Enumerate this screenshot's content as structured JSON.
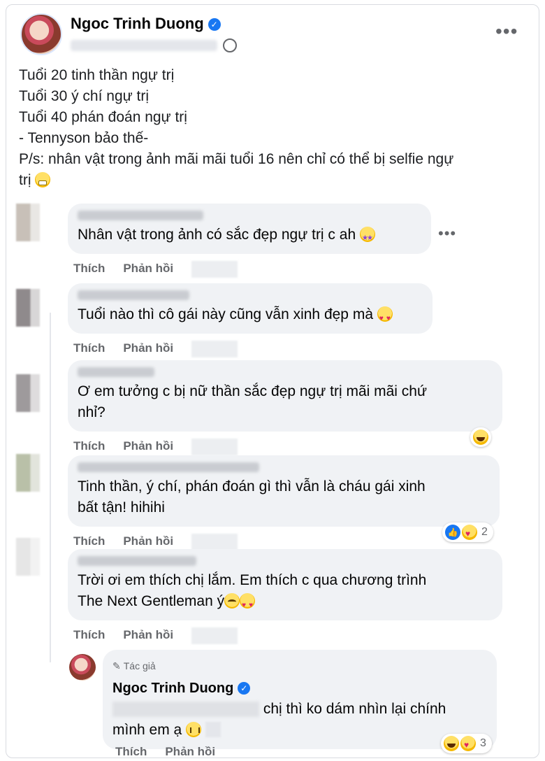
{
  "post": {
    "author": "Ngoc Trinh Duong",
    "lines": [
      "Tuổi 20 tinh thần ngự trị",
      "Tuổi 30 ý chí ngự trị",
      "Tuổi 40 phán đoán ngự trị",
      "- Tennyson bảo thế-",
      "P/s: nhân vật trong ảnh mãi mãi tuổi 16 nên chỉ có thể bị selfie ngự",
      "trị"
    ]
  },
  "actions": {
    "like": "Thích",
    "reply": "Phản hồi"
  },
  "comments": [
    {
      "text": "Nhân vật trong ảnh có sắc đẹp ngự trị c ah",
      "emoji": "star-struck-icon"
    },
    {
      "text": "Tuổi nào thì cô gái này cũng vẫn xinh đẹp mà",
      "emoji": "heart-eyes-icon"
    },
    {
      "text_lines": [
        "Ơ em tưởng c bị nữ thần sắc đẹp ngự trị mãi mãi chứ",
        "nhỉ?"
      ]
    },
    {
      "text_lines": [
        "Tinh thần, ý chí, phán đoán gì thì vẫn là cháu gái xinh",
        "bất tận! hihihi"
      ],
      "reaction_count": "2"
    },
    {
      "text_lines": [
        "Trời ơi em thích chị lắm. Em thích c qua chương trình",
        "The Next Gentleman ý"
      ]
    }
  ],
  "reply": {
    "tag": "Tác giả",
    "name": "Ngoc Trinh Duong",
    "line1_visible": "chị thì ko dám nhìn lại chính",
    "line2": "mình em ạ",
    "reaction_count": "3"
  }
}
